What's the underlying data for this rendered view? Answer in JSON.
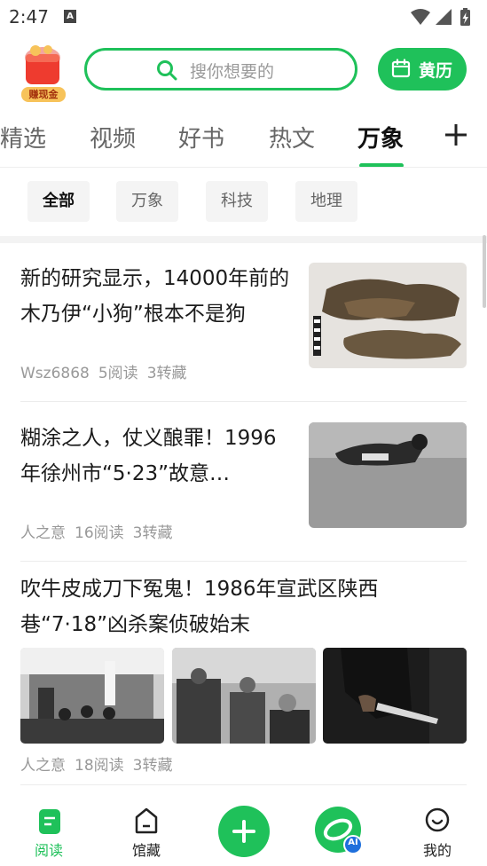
{
  "status_bar": {
    "time": "2:47",
    "notif_letter": "A"
  },
  "header": {
    "cash_label": "赚现金",
    "search_placeholder": "搜你想要的",
    "calendar_label": "黄历"
  },
  "tabs": [
    {
      "label": "精选"
    },
    {
      "label": "视频"
    },
    {
      "label": "好书"
    },
    {
      "label": "热文"
    },
    {
      "label": "万象"
    }
  ],
  "chips": [
    {
      "label": "全部"
    },
    {
      "label": "万象"
    },
    {
      "label": "科技"
    },
    {
      "label": "地理"
    }
  ],
  "articles": [
    {
      "title": "新的研究显示，14000年前的木乃伊“小狗”根本不是狗",
      "author": "Wsz6868",
      "reads": "5阅读",
      "saves": "3转藏"
    },
    {
      "title": "糊涂之人，仗义酿罪！1996年徐州市“5·23”故意…",
      "author": "人之意",
      "reads": "16阅读",
      "saves": "3转藏"
    },
    {
      "title": "吹牛皮成刀下冤鬼！1986年宣武区陕西巷“7·18”凶杀案侦破始末",
      "author": "人之意",
      "reads": "18阅读",
      "saves": "3转藏"
    }
  ],
  "bottom_nav": {
    "read": "阅读",
    "collection": "馆藏",
    "ai_badge": "AI",
    "mine": "我的"
  },
  "colors": {
    "brand_green": "#1fc15a"
  }
}
